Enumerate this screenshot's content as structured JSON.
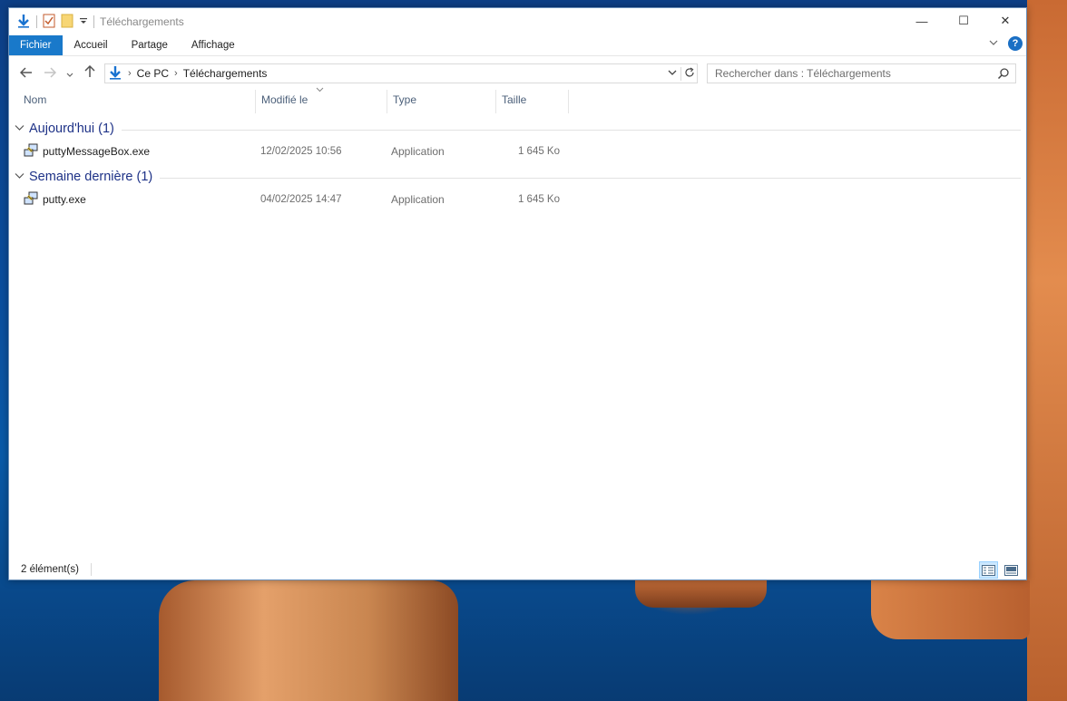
{
  "window": {
    "title": "Téléchargements",
    "controls": {
      "minimize": "—",
      "maximize": "☐",
      "close": "✕"
    }
  },
  "ribbon": {
    "tabs": [
      "Fichier",
      "Accueil",
      "Partage",
      "Affichage"
    ],
    "help": "?"
  },
  "address_bar": {
    "crumbs": [
      "Ce PC",
      "Téléchargements"
    ]
  },
  "search": {
    "placeholder": "Rechercher dans : Téléchargements"
  },
  "columns": {
    "name": "Nom",
    "modified": "Modifié le",
    "type": "Type",
    "size": "Taille"
  },
  "groups": [
    {
      "label": "Aujourd'hui (1)",
      "files": [
        {
          "name": "puttyMessageBox.exe",
          "modified": "12/02/2025 10:56",
          "type": "Application",
          "size": "1 645 Ko"
        }
      ]
    },
    {
      "label": "Semaine dernière (1)",
      "files": [
        {
          "name": "putty.exe",
          "modified": "04/02/2025 14:47",
          "type": "Application",
          "size": "1 645 Ko"
        }
      ]
    }
  ],
  "status": {
    "count": "2 élément(s)"
  },
  "colors": {
    "accent": "#1979ca",
    "group_header": "#1e3287"
  }
}
